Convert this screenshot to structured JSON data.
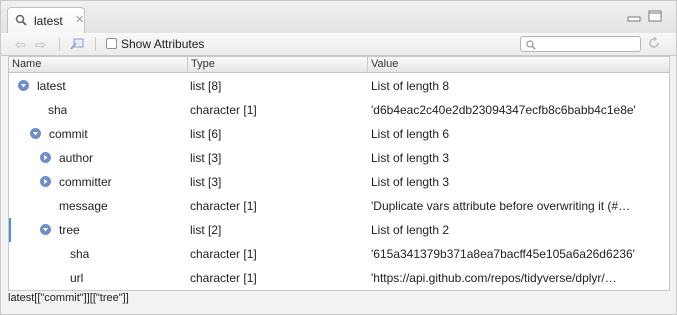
{
  "tab": {
    "title": "latest"
  },
  "toolbar": {
    "show_attributes_label": "Show Attributes",
    "search_placeholder": ""
  },
  "columns": {
    "name": "Name",
    "type": "Type",
    "value": "Value"
  },
  "rows": [
    {
      "name": "latest",
      "type": "list [8]",
      "value": "List of length 8"
    },
    {
      "name": "sha",
      "type": "character [1]",
      "value": "'d6b4eac2c40e2db23094347ecfb8c6babb4c1e8e'"
    },
    {
      "name": "commit",
      "type": "list [6]",
      "value": "List of length 6"
    },
    {
      "name": "author",
      "type": "list [3]",
      "value": "List of length 3"
    },
    {
      "name": "committer",
      "type": "list [3]",
      "value": "List of length 3"
    },
    {
      "name": "message",
      "type": "character [1]",
      "value": "'Duplicate vars attribute before overwriting it (#…"
    },
    {
      "name": "tree",
      "type": "list [2]",
      "value": "List of length 2"
    },
    {
      "name": "sha",
      "type": "character [1]",
      "value": "'615a341379b371a8ea7bacff45e105a6a26d6236'"
    },
    {
      "name": "url",
      "type": "character [1]",
      "value": "'https://api.github.com/repos/tidyverse/dplyr/…"
    }
  ],
  "status": {
    "path": "latest[[\"commit\"]][[\"tree\"]]"
  },
  "colors": {
    "arrow": "#6f8ec9",
    "selection_bar": "#4a90e2"
  },
  "icons": [
    "search-icon",
    "close-icon",
    "minimize-icon",
    "maximize-icon",
    "back-arrow-icon",
    "forward-arrow-icon",
    "clean-icon",
    "refresh-icon",
    "expanded-arrow-icon",
    "collapsed-arrow-icon"
  ]
}
